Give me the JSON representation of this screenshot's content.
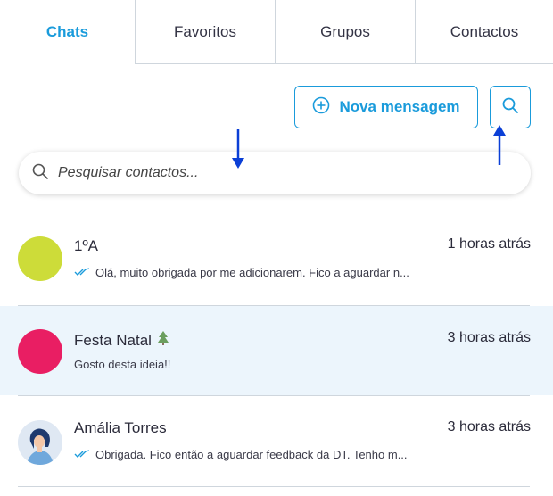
{
  "tabs": [
    {
      "label": "Chats",
      "active": true
    },
    {
      "label": "Favoritos",
      "active": false
    },
    {
      "label": "Grupos",
      "active": false
    },
    {
      "label": "Contactos",
      "active": false
    }
  ],
  "actions": {
    "new_message_label": "Nova mensagem",
    "new_message_icon": "plus-circle-icon",
    "search_icon": "search-icon"
  },
  "search": {
    "placeholder": "Pesquisar contactos..."
  },
  "chats": [
    {
      "name": "1ºA",
      "time": "1 horas atrás",
      "preview": "Olá, muito obrigada por me adicionarem. Fico a aguardar n...",
      "read_receipt": true,
      "avatar": "circle",
      "avatar_color": "#cddc39",
      "emoji": ""
    },
    {
      "name": "Festa Natal",
      "time": "3 horas atrás",
      "preview": "Gosto desta ideia!!",
      "read_receipt": false,
      "avatar": "circle",
      "avatar_color": "#e91e63",
      "emoji": "tree-icon",
      "highlighted": true
    },
    {
      "name": "Amália Torres",
      "time": "3 horas atrás",
      "preview": "Obrigada. Fico então a aguardar feedback da DT.  Tenho m...",
      "read_receipt": true,
      "avatar": "person",
      "avatar_color": "#dfe8f3",
      "emoji": ""
    }
  ],
  "colors": {
    "accent": "#1a9bdb",
    "annotation_arrow": "#0b3fd6",
    "highlight_row": "#ecf5fc",
    "divider": "#cfd6dd"
  }
}
